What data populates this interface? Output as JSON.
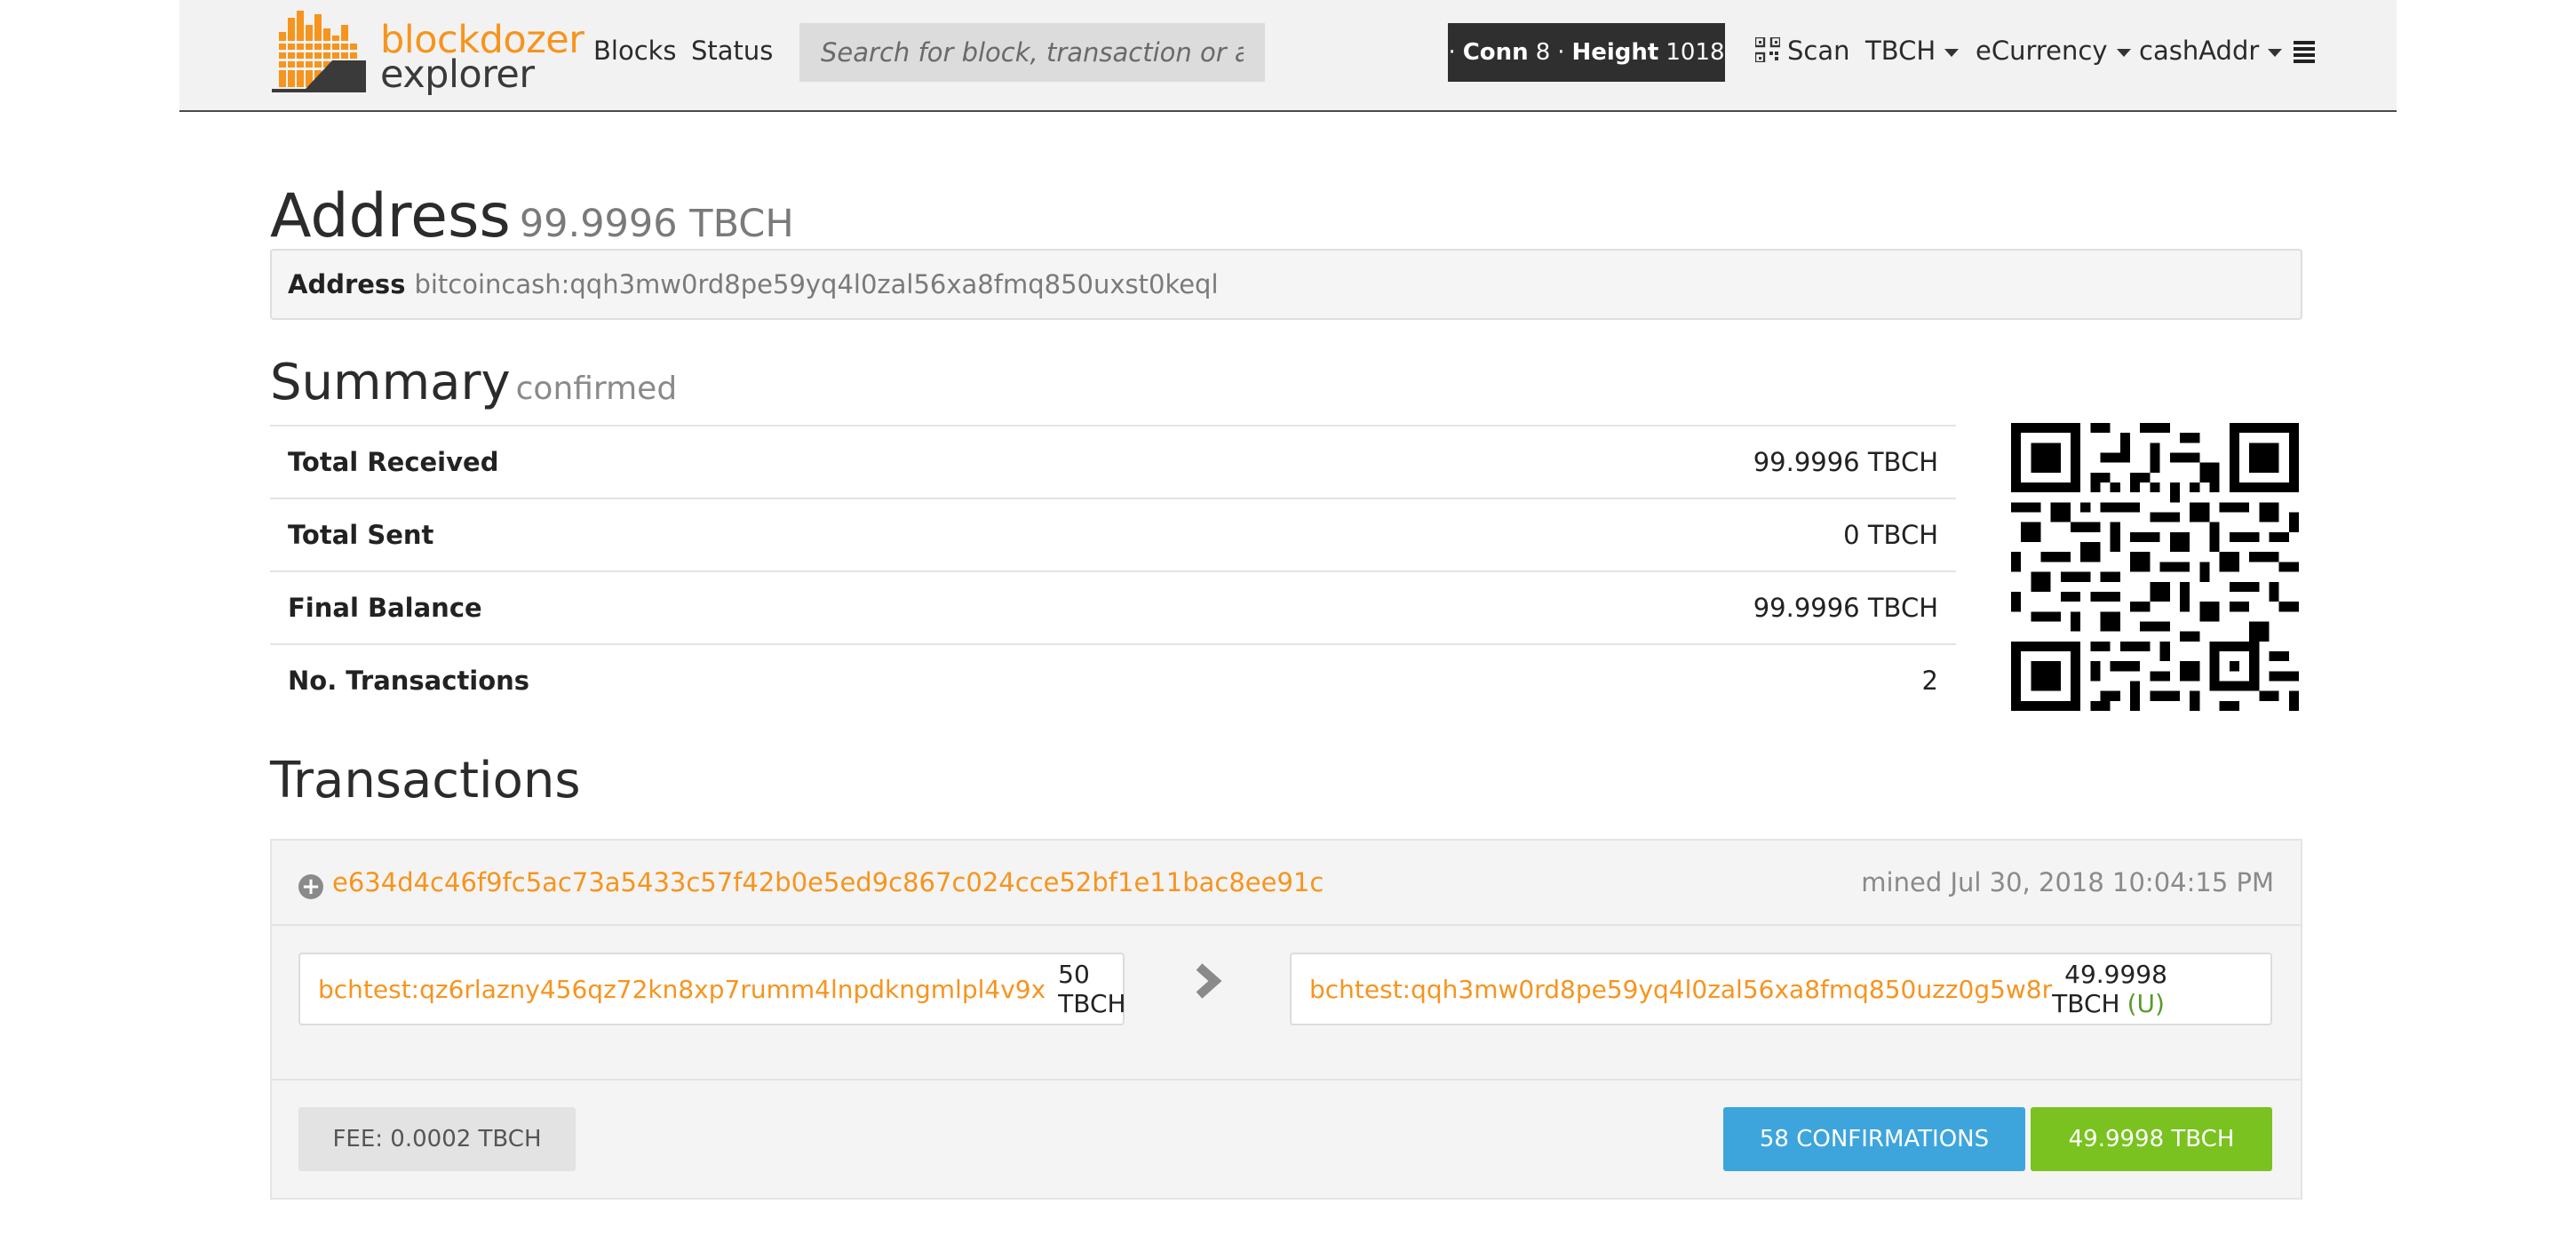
{
  "header": {
    "logo_top": "blockdozer",
    "logo_bottom": "explorer",
    "nav_blocks": "Blocks",
    "nav_status": "Status",
    "search_placeholder": "Search for block, transaction or address",
    "conn_label": "Conn",
    "conn_value": "8",
    "height_label": "Height",
    "height_value": "1018",
    "scan_label": "Scan",
    "currency_dd": "TBCH",
    "ecurrency_dd": "eCurrency",
    "format_dd": "cashAddr"
  },
  "address": {
    "title": "Address",
    "balance": "99.9996 TBCH",
    "label": "Address",
    "value": "bitcoincash:qqh3mw0rd8pe59yq4l0zal56xa8fmq850uxst0keql"
  },
  "summary": {
    "title": "Summary",
    "subtitle": "confirmed",
    "rows": [
      {
        "label": "Total Received",
        "value": "99.9996 TBCH"
      },
      {
        "label": "Total Sent",
        "value": "0 TBCH"
      },
      {
        "label": "Final Balance",
        "value": "99.9996 TBCH"
      },
      {
        "label": "No. Transactions",
        "value": "2"
      }
    ]
  },
  "transactions": {
    "title": "Transactions",
    "items": [
      {
        "txid": "e634d4c46f9fc5ac73a5433c57f42b0e5ed9c867c024cce52bf1e11bac8ee91c",
        "mined": "mined Jul 30, 2018 10:04:15 PM",
        "input_address": "bchtest:qz6rlazny456qz72kn8xp7rumm4lnpdkngmlpl4v9x",
        "input_amount": "50 TBCH",
        "output_address": "bchtest:qqh3mw0rd8pe59yq4l0zal56xa8fmq850uzz0g5w8r",
        "output_amount": "49.9998 TBCH",
        "output_flag": "(U)",
        "fee": "FEE: 0.0002 TBCH",
        "confirmations": "58 CONFIRMATIONS",
        "total": "49.9998 TBCH"
      }
    ]
  },
  "colors": {
    "accent": "#f7941d",
    "confirm_blue": "#3da5dc",
    "total_green": "#7ac21f",
    "conn_bg": "#2f2f2f"
  }
}
